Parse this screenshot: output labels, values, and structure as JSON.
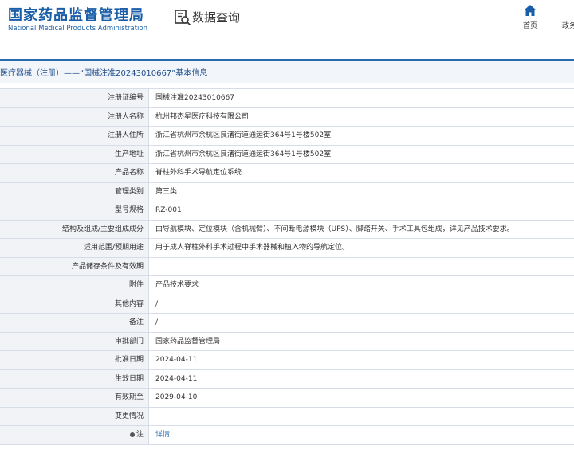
{
  "header": {
    "brand_cn": "国家药品监督管理局",
    "brand_en": "National Medical Products Administration",
    "query_label": "数据查询",
    "nav_home": "首页",
    "nav_gov": "政务"
  },
  "title": "医疗器械（注册）——“国械注准20243010667”基本信息",
  "rows": [
    {
      "label": "注册证编号",
      "value": "国械注准20243010667"
    },
    {
      "label": "注册人名称",
      "value": "杭州邦杰星医疗科技有限公司"
    },
    {
      "label": "注册人住所",
      "value": "浙江省杭州市余杭区良渚街道通运街364号1号楼502室"
    },
    {
      "label": "生产地址",
      "value": "浙江省杭州市余杭区良渚街道通运街364号1号楼502室"
    },
    {
      "label": "产品名称",
      "value": "脊柱外科手术导航定位系统"
    },
    {
      "label": "管理类别",
      "value": "第三类"
    },
    {
      "label": "型号规格",
      "value": "RZ-001"
    },
    {
      "label": "结构及组成/主要组成成分",
      "value": "由导航模块、定位模块（含机械臂）、不间断电源模块（UPS）、脚踏开关、手术工具包组成，详见产品技术要求。"
    },
    {
      "label": "适用范围/预期用途",
      "value": "用于成人脊柱外科手术过程中手术器械和植入物的导航定位。"
    },
    {
      "label": "产品储存条件及有效期",
      "value": ""
    },
    {
      "label": "附件",
      "value": "产品技术要求"
    },
    {
      "label": "其他内容",
      "value": "/"
    },
    {
      "label": "备注",
      "value": "/"
    },
    {
      "label": "审批部门",
      "value": "国家药品监督管理局"
    },
    {
      "label": "批准日期",
      "value": "2024-04-11"
    },
    {
      "label": "生效日期",
      "value": "2024-04-11"
    },
    {
      "label": "有效期至",
      "value": "2029-04-10"
    },
    {
      "label": "变更情况",
      "value": ""
    }
  ],
  "note": {
    "label": "注",
    "link": "详情"
  }
}
